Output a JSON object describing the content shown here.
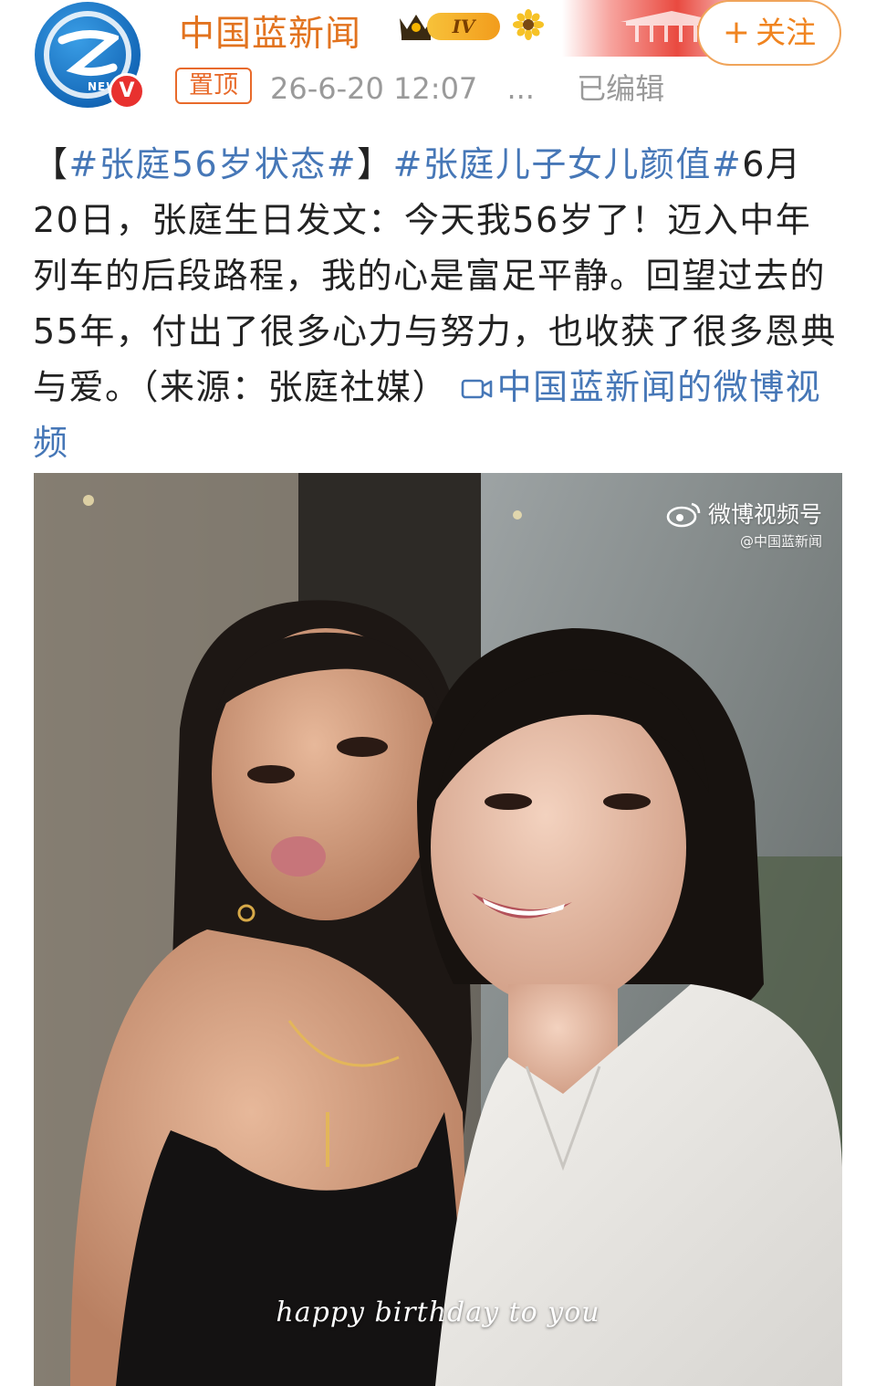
{
  "header": {
    "account_name": "中国蓝新闻",
    "level_badge": "IV",
    "follow_label": "关注",
    "follow_icon": "plus-icon",
    "pinned_label": "置顶",
    "timestamp": "26-6-20 12:07",
    "more": "...",
    "edited": "已编辑",
    "verified_badge": "V"
  },
  "post": {
    "bracket_open": "【",
    "hashtag_1": "#张庭56岁状态#",
    "bracket_close": "】",
    "hashtag_2": "#张庭儿子女儿颜值#",
    "body": "6月20日，张庭生日发文：今天我56岁了！迈入中年列车的后段路程，我的心是富足平静。回望过去的55年，付出了很多心力与努力，也收获了很多恩典与爱。（来源：张庭社媒）",
    "video_link_label": "中国蓝新闻的微博视频"
  },
  "video": {
    "watermark_title": "微博视频号",
    "watermark_sub": "@中国蓝新闻",
    "caption": "happy birthday to you"
  },
  "colors": {
    "account_name": "#e2731f",
    "link": "#4677b7",
    "follow": "#f08420",
    "verified": "#e8312f"
  }
}
